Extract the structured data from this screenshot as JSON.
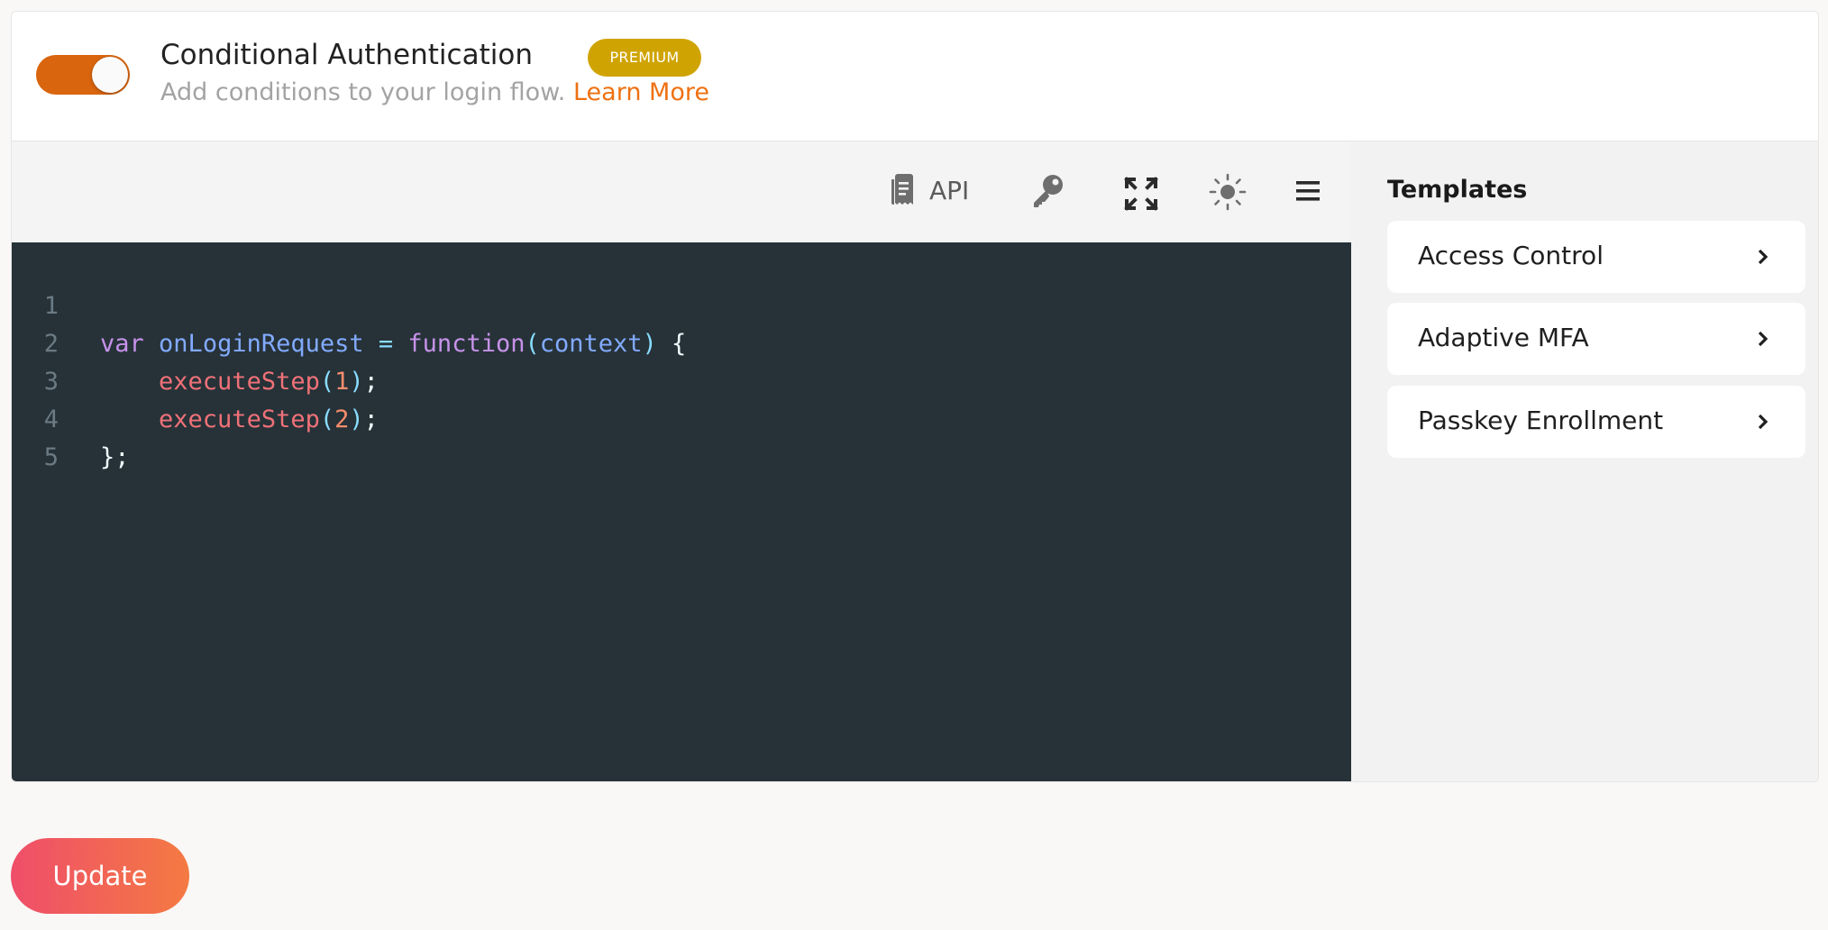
{
  "header": {
    "enabled": true,
    "title": "Conditional Authentication",
    "badge": "PREMIUM",
    "subtitle": "Add conditions to your login flow.",
    "learn_more": "Learn More"
  },
  "toolbar": {
    "api_label": "API",
    "icons": [
      "api-doc-icon",
      "key-icon",
      "expand-icon",
      "theme-sun-icon",
      "menu-icon"
    ]
  },
  "editor": {
    "line_numbers": [
      "1",
      "2",
      "3",
      "4",
      "5"
    ],
    "lines": [
      "var onLoginRequest = function(context) {",
      "    executeStep(1);",
      "    executeStep(2);",
      "};",
      ""
    ]
  },
  "templates": {
    "title": "Templates",
    "items": [
      {
        "label": "Access Control"
      },
      {
        "label": "Adaptive MFA"
      },
      {
        "label": "Passkey Enrollment"
      }
    ]
  },
  "footer": {
    "update_label": "Update"
  },
  "colors": {
    "accent_orange": "#ee7112",
    "toggle_on": "#d9650e",
    "premium_badge": "#cfa402",
    "editor_bg": "#263238",
    "update_gradient_start": "#ef4e6a",
    "update_gradient_end": "#f47a42"
  }
}
